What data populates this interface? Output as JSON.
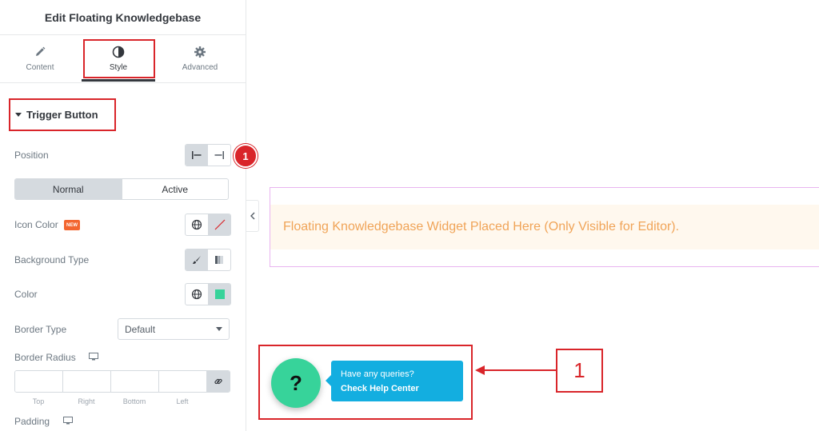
{
  "panel": {
    "title": "Edit Floating Knowledgebase",
    "tabs": [
      {
        "label": "Content",
        "icon": "pencil-icon"
      },
      {
        "label": "Style",
        "icon": "contrast-icon"
      },
      {
        "label": "Advanced",
        "icon": "gear-icon"
      }
    ],
    "active_tab": "Style",
    "section": {
      "title": "Trigger Button",
      "expanded": true
    },
    "controls": {
      "position": {
        "label": "Position",
        "options": [
          "align-left-icon",
          "align-right-icon"
        ],
        "selected": 0
      },
      "state_tabs": [
        "Normal",
        "Active"
      ],
      "active_state": "Normal",
      "icon_color": {
        "label": "Icon Color",
        "badge": "NEW"
      },
      "background_type": {
        "label": "Background Type",
        "options": [
          "brush-icon",
          "gradient-icon"
        ],
        "selected": 0
      },
      "color": {
        "label": "Color",
        "swatch": "#37d39a"
      },
      "border_type": {
        "label": "Border Type",
        "value": "Default"
      },
      "border_radius": {
        "label": "Border Radius",
        "fields": [
          "Top",
          "Right",
          "Bottom",
          "Left"
        ]
      },
      "padding": {
        "label": "Padding"
      }
    },
    "step_marker": "1"
  },
  "canvas": {
    "placeholder_text": "Floating Knowledgebase Widget Placed Here (Only Visible for Editor).",
    "help_button": {
      "symbol": "?",
      "line1": "Have any queries?",
      "line2": "Check Help Center"
    },
    "callout_number": "1"
  },
  "colors": {
    "accent_red": "#d9252a",
    "help_green": "#37d39a",
    "tooltip_blue": "#13aee0",
    "placeholder_orange": "#f0a458"
  }
}
